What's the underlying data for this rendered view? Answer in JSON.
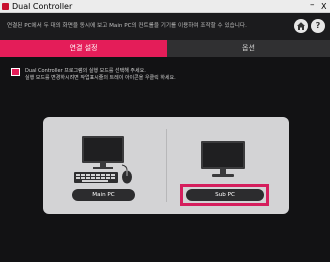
{
  "window": {
    "title": "Dual Controller",
    "minimize_glyph": "–",
    "close_glyph": "X"
  },
  "header": {
    "description": "연결된 PC에서 두 대의 화면을 동시에 보고 Main PC의 컨트롤을 기기를 이용하여 조작할 수 있습니다.",
    "home_icon": "home-icon",
    "help_label": "?"
  },
  "tabs": [
    {
      "label": "연결 설정",
      "active": true
    },
    {
      "label": "옵션",
      "active": false
    }
  ],
  "notice": {
    "line1": "Dual Controller 프로그램의 실행 모드를 선택해 주세요.",
    "line2": "실행 모드를 변경하시려면 작업표시줄의 트레이 아이콘을 우클릭 하세요."
  },
  "modes": {
    "main_pc_label": "Main PC",
    "sub_pc_label": "Sub PC",
    "selected": "Sub PC"
  },
  "colors": {
    "accent": "#e41d59",
    "highlight_border": "#d51e5d",
    "panel_bg": "#d3d3d5",
    "window_bg": "#121214"
  }
}
